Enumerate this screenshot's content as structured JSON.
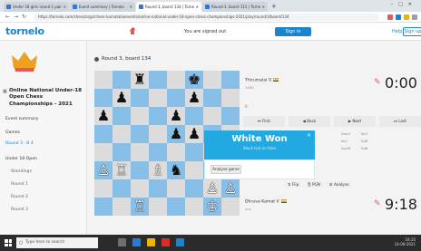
{
  "browser": {
    "tabs": [
      {
        "label": "Under 18 girls round 1 pairings"
      },
      {
        "label": "Event summary | Tornelo"
      },
      {
        "label": "Round 3, board 134 | Tornelo"
      },
      {
        "label": "Round 3, board 115 | Tornelo"
      }
    ],
    "url": "https://tornelo.com/chess/orgs/chess-karnataka/events/online-national-under-18-open-chess-championships-2021/play/round/3/board/134"
  },
  "header": {
    "logo": "tornelo",
    "signed_out_text": "You are signed out",
    "signin_label": "Sign in",
    "help_label": "Help",
    "signup_label": "Sign up"
  },
  "sidebar": {
    "event_title": "Online National Under-18 Open Chess Championships - 2021",
    "items": [
      {
        "label": "Event summary"
      },
      {
        "label": "Games"
      },
      {
        "label": "Round 3 · B 4"
      },
      {
        "label": "Under 18 Open"
      },
      {
        "label": "Standings"
      },
      {
        "label": "Round 1"
      },
      {
        "label": "Round 2"
      },
      {
        "label": "Round 3"
      }
    ]
  },
  "game": {
    "round_label": "Round 3, board 134",
    "top_player": {
      "name": "Thirumalai G",
      "rating": "1450"
    },
    "bottom_player": {
      "name": "Dhruva Kamat V",
      "rating": "unr."
    },
    "clock_top": "0:00",
    "clock_bottom": "9:18",
    "moves_count": "0",
    "controls": [
      {
        "label": "First"
      },
      {
        "label": "Back"
      },
      {
        "label": "Next"
      },
      {
        "label": "Last"
      }
    ],
    "move_rows": [
      [
        "Dxe4",
        "Ke5"
      ],
      [
        "Ke7",
        "Kd6"
      ],
      [
        "Dxd6",
        "Kd8"
      ]
    ],
    "actions": [
      {
        "label": "Flip"
      },
      {
        "label": "PGN"
      },
      {
        "label": "Analyse"
      }
    ]
  },
  "popup": {
    "title": "White Won",
    "subtitle": "Black lost on time",
    "analyse_label": "Analyse game",
    "close": "×"
  },
  "board": {
    "rows": [
      [
        "",
        "",
        "♜",
        "",
        "",
        "♚",
        "",
        ""
      ],
      [
        "",
        "♟",
        "",
        "",
        "",
        "♟",
        "",
        ""
      ],
      [
        "♟",
        "",
        "",
        "",
        "♟",
        "",
        "",
        ""
      ],
      [
        "",
        "",
        "",
        "",
        "♟",
        "♟",
        "",
        ""
      ],
      [
        "",
        "",
        "",
        "",
        "",
        "",
        "",
        ""
      ],
      [
        "♙",
        "♖",
        "",
        "♗",
        "♞",
        "",
        "",
        "♙"
      ],
      [
        "",
        "",
        "",
        "",
        "",
        "",
        "♙",
        "♙"
      ],
      [
        "",
        "",
        "♖",
        "",
        "",
        "",
        "♔",
        ""
      ]
    ]
  },
  "taskbar": {
    "search_placeholder": "Type here to search",
    "time": "16:35",
    "date": "14-08-2021"
  },
  "colors": {
    "brand": "#1d84c9",
    "board_light": "#dcdcdc",
    "board_dark": "#88bfe8",
    "popup": "#23a9e1"
  }
}
